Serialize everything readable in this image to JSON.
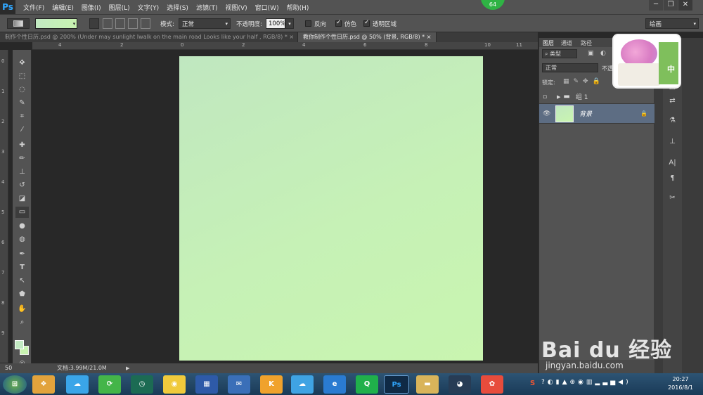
{
  "app": {
    "logo": "Ps",
    "badge": "64"
  },
  "menu": [
    "文件(F)",
    "编辑(E)",
    "图像(I)",
    "图层(L)",
    "文字(Y)",
    "选择(S)",
    "滤镜(T)",
    "视图(V)",
    "窗口(W)",
    "帮助(H)"
  ],
  "window_controls": {
    "minimize": "─",
    "restore": "❐",
    "close": "✕"
  },
  "options": {
    "mode_label": "模式:",
    "mode_value": "正常",
    "opacity_label": "不透明度:",
    "opacity_value": "100%",
    "reverse_label": "反向",
    "dither_label": "仿色",
    "transparency_label": "透明区域",
    "workspace_value": "绘画",
    "reverse_checked": false,
    "dither_checked": true,
    "transparency_checked": true
  },
  "tabs": [
    {
      "label": "制作个性日历.psd @ 200% (Under may sunlight Iwalk on the main road Looks like your half , RGB/8) *",
      "close": "×"
    },
    {
      "label": "教你制作个性日历.psd @ 50% (背景, RGB/8) *",
      "close": "×",
      "active": true
    }
  ],
  "ruler": {
    "h": [
      "4",
      "2",
      "0",
      "2",
      "4",
      "6",
      "8",
      "10",
      "4",
      "8",
      "10",
      "11"
    ],
    "v": [
      "0",
      "1",
      "2",
      "3",
      "4",
      "5",
      "6",
      "7",
      "8",
      "9"
    ]
  },
  "status": {
    "zoom": "50",
    "doc": "文档:3.99M/21.0M"
  },
  "layers_panel": {
    "tabs": [
      "图层",
      "通道",
      "路径"
    ],
    "filter_label": "类型",
    "blend_mode": "正常",
    "opacity_label": "不透",
    "lock_label": "锁定:",
    "layers": [
      {
        "name": "组 1",
        "type": "group"
      },
      {
        "name": "背景",
        "type": "background",
        "selected": true
      }
    ]
  },
  "thumbnail": {
    "ime_char": "中"
  },
  "taskbar": {
    "time": "20:27",
    "date": "2016/8/1",
    "ps_label": "Ps",
    "ime": "S"
  },
  "watermark": {
    "brand": "Bai du 经验",
    "url": "jingyan.baidu.com"
  },
  "colors": {
    "fg": "#c2e9c2",
    "bg": "#c8f3b0",
    "canvas_start": "#c0e7c0",
    "canvas_end": "#c9f5b0"
  }
}
